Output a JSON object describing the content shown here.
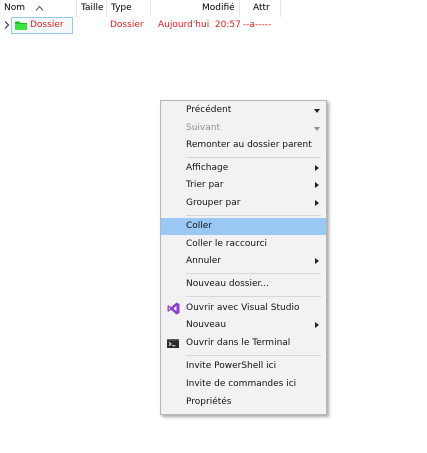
{
  "header": {
    "columns": [
      {
        "key": "name",
        "label": "Nom"
      },
      {
        "key": "size",
        "label": "Taille"
      },
      {
        "key": "type",
        "label": "Type"
      },
      {
        "key": "modified",
        "label": "Modifié"
      },
      {
        "key": "attr",
        "label": "Attr"
      }
    ],
    "sort_icon": "sort-ascending-icon"
  },
  "file": {
    "name": "Dossier",
    "type": "Dossier",
    "modified": "Aujourd'hui  20:57",
    "attr": "--a-----",
    "icon": "folder-icon",
    "color": "#e0201d"
  },
  "menu": {
    "items": [
      {
        "label": "Précédent",
        "submenu": "down"
      },
      {
        "label": "Suivant",
        "submenu": "down",
        "disabled": true
      },
      {
        "label": "Remonter au dossier parent"
      },
      {
        "label": "Affichage",
        "submenu": "right"
      },
      {
        "label": "Trier par",
        "submenu": "right"
      },
      {
        "label": "Grouper par",
        "submenu": "right"
      },
      {
        "label": "Coller",
        "highlighted": true
      },
      {
        "label": "Coller le raccourci"
      },
      {
        "label": "Annuler",
        "submenu": "right"
      },
      {
        "label": "Nouveau dossier..."
      },
      {
        "label": "Ouvrir avec Visual Studio",
        "icon": "visual-studio-icon"
      },
      {
        "label": "Nouveau",
        "submenu": "right"
      },
      {
        "label": "Ouvrir dans le Terminal",
        "icon": "terminal-icon"
      },
      {
        "label": "Invite PowerShell ici"
      },
      {
        "label": "Invite de commandes ici"
      },
      {
        "label": "Propriétés"
      }
    ],
    "highlight_color": "#9ac7f3"
  }
}
